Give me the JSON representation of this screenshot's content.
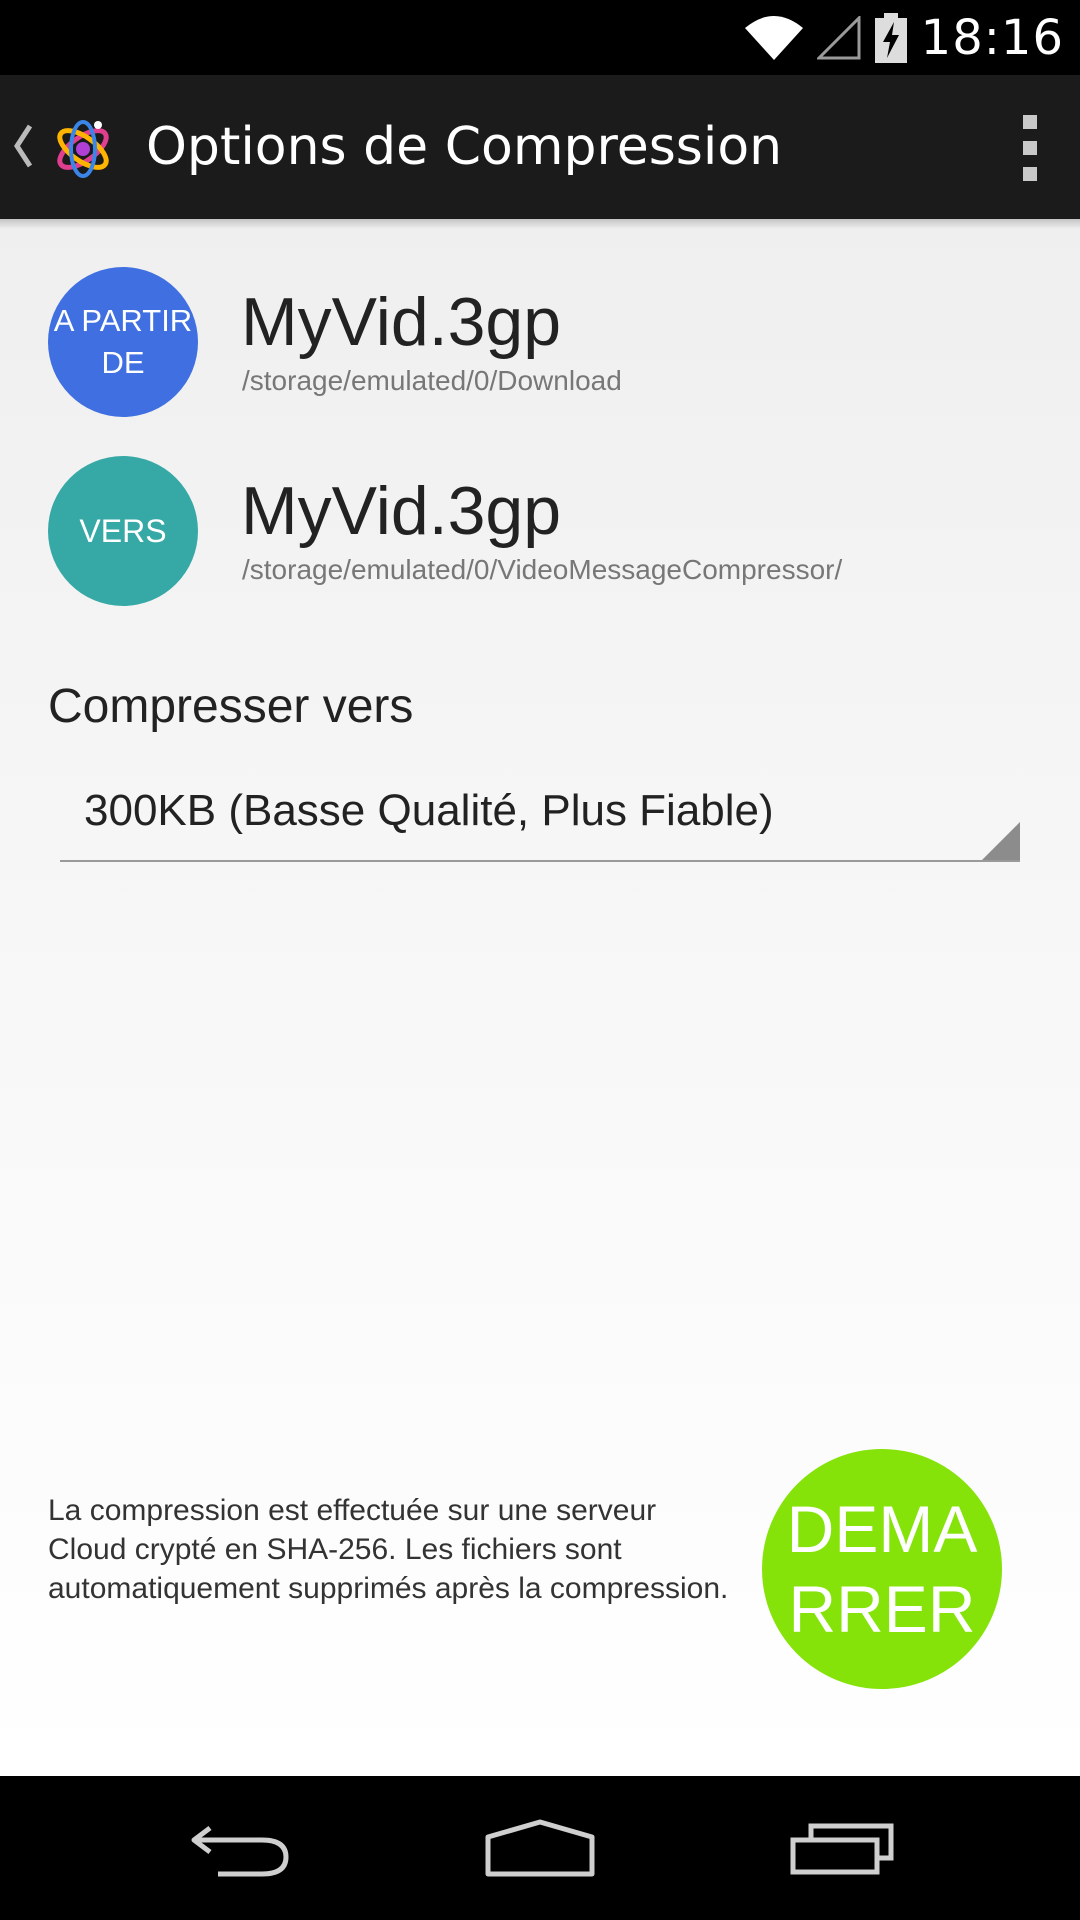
{
  "status_bar": {
    "time": "18:16",
    "icons": [
      "wifi-icon",
      "cell-signal-icon",
      "battery-charging-icon"
    ]
  },
  "action_bar": {
    "title": "Options de Compression",
    "icons": [
      "back-chevron-icon",
      "app-logo-icon",
      "overflow-menu-icon"
    ]
  },
  "source": {
    "badge": "A PARTIR DE",
    "file_name": "MyVid.3gp",
    "path": "/storage/emulated/0/Download",
    "color": "#3f6fe0"
  },
  "destination": {
    "badge": "VERS",
    "file_name": "MyVid.3gp",
    "path": "/storage/emulated/0/VideoMessageCompressor/",
    "color": "#36a9a6"
  },
  "compression": {
    "label": "Compresser vers",
    "selected": "300KB (Basse Qualité, Plus Fiable)"
  },
  "disclaimer": "La compression est effectuée sur une serveur Cloud crypté en SHA-256. Les fichiers sont automatiquement supprimés après la compression.",
  "start_button": {
    "label": "DEMARRER",
    "color": "#86e30a"
  },
  "nav_bar": {
    "icons": [
      "nav-back-icon",
      "nav-home-icon",
      "nav-recents-icon"
    ]
  }
}
